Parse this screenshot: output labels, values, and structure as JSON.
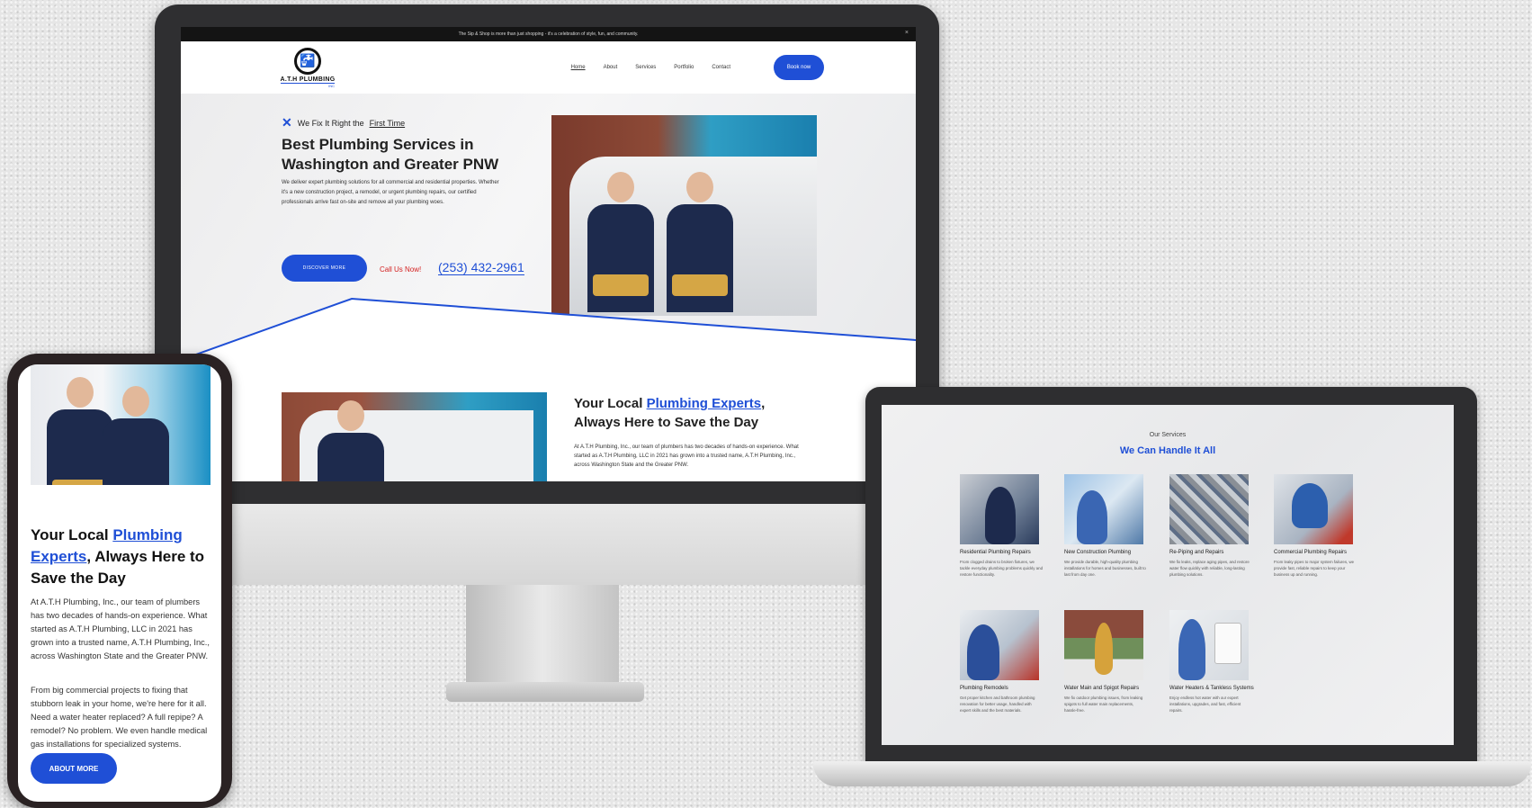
{
  "desktop": {
    "announcement": "The Sip & Shop is more than just shopping - it's a celebration of style, fun, and community.",
    "close_icon": "×",
    "logo": {
      "name": "A.T.H PLUMBING",
      "suffix": "INC"
    },
    "nav": {
      "home": "Home",
      "about": "About",
      "services": "Services",
      "portfolio": "Portfolio",
      "contact": "Contact",
      "book": "Book now"
    },
    "hero": {
      "tagline_prefix": "We Fix It Right the",
      "tagline_link": "First Time",
      "title": "Best Plumbing Services in Washington and Greater PNW",
      "description": "We deliver expert plumbing solutions for all commercial and residential properties. Whether it's a new construction project, a remodel, or urgent plumbing repairs, our certified professionals arrive fast on-site and remove all your plumbing woes.",
      "discover_button": "DISCOVER MORE",
      "call_label": "Call Us Now!",
      "phone": "(253) 432-2961"
    },
    "about": {
      "title_prefix": "Your Local ",
      "title_highlight": "Plumbing Experts",
      "title_suffix": ", Always Here to Save the Day",
      "description": "At A.T.H Plumbing, Inc., our team of plumbers has two decades of hands-on experience. What started as A.T.H Plumbing, LLC in 2021 has grown into a trusted name, A.T.H Plumbing, Inc., across Washington State and the Greater PNW."
    }
  },
  "mobile": {
    "title_prefix": "Your Local ",
    "title_highlight": "Plumbing Experts",
    "title_suffix": ", Always Here to Save the Day",
    "paragraph1": "At A.T.H Plumbing, Inc., our team of plumbers has two decades of hands-on experience. What started as A.T.H Plumbing, LLC in 2021 has grown into a trusted name, A.T.H Plumbing, Inc., across Washington State and the Greater PNW.",
    "paragraph2": "From big commercial projects to fixing that stubborn leak in your home, we're here for it all. Need a water heater replaced? A full repipe? A remodel? No problem. We even handle medical gas installations for specialized systems.",
    "button": "ABOUT MORE"
  },
  "laptop": {
    "kicker": "Our Services",
    "title": "We Can Handle It All",
    "services": [
      {
        "name": "Residential Plumbing Repairs",
        "desc": "From clogged drains to broken fixtures, we tackle everyday plumbing problems quickly and restore functionality."
      },
      {
        "name": "New Construction Plumbing",
        "desc": "We provide durable, high-quality plumbing installations for homes and businesses, built to last from day one."
      },
      {
        "name": "Re-Piping and Repairs",
        "desc": "We fix leaks, replace aging pipes, and restore water flow quickly with reliable, long-lasting plumbing solutions."
      },
      {
        "name": "Commercial Plumbing Repairs",
        "desc": "From leaky pipes to major system failures, we provide fast, reliable repairs to keep your business up and running."
      },
      {
        "name": "Plumbing Remodels",
        "desc": "Get proper kitchen and bathroom plumbing renovation for better usage, handled with expert skills and the best materials."
      },
      {
        "name": "Water Main and Spigot Repairs",
        "desc": "We fix outdoor plumbing issues, from leaking spigots to full water main replacements, hassle-free."
      },
      {
        "name": "Water Heaters & Tankless Systems",
        "desc": "Enjoy endless hot water with our expert installations, upgrades, and fast, efficient repairs."
      }
    ]
  },
  "colors": {
    "accent": "#1f4fd6",
    "call": "#d42020",
    "dark": "#141414"
  }
}
